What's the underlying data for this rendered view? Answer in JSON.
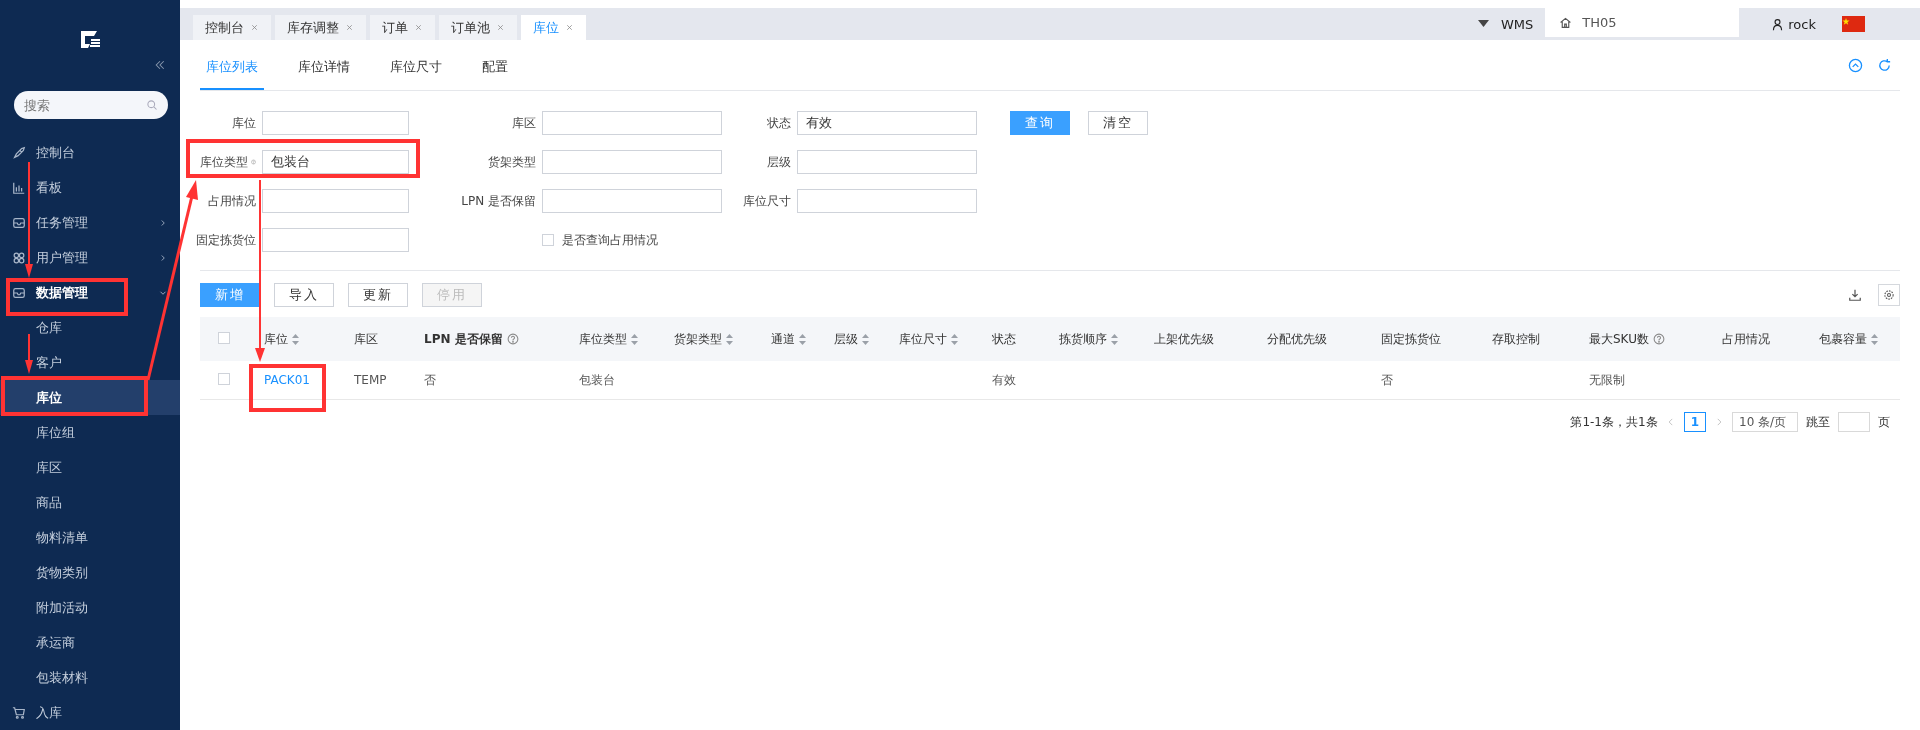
{
  "sidebar": {
    "search": {
      "placeholder": "搜索"
    },
    "menu": [
      {
        "label": "控制台",
        "selected": false
      },
      {
        "label": "看板",
        "selected": false
      },
      {
        "label": "任务管理",
        "selected": false,
        "expanded": false
      },
      {
        "label": "用户管理",
        "selected": false,
        "expanded": false
      },
      {
        "label": "数据管理",
        "selected": false,
        "expanded": true,
        "children": [
          {
            "label": "仓库",
            "selected": false
          },
          {
            "label": "客户",
            "selected": false
          },
          {
            "label": "库位",
            "selected": true
          },
          {
            "label": "库位组",
            "selected": false
          },
          {
            "label": "库区",
            "selected": false
          },
          {
            "label": "商品",
            "selected": false
          },
          {
            "label": "物料清单",
            "selected": false
          },
          {
            "label": "货物类别",
            "selected": false
          },
          {
            "label": "附加活动",
            "selected": false
          },
          {
            "label": "承运商",
            "selected": false
          },
          {
            "label": "包装材料",
            "selected": false
          }
        ]
      },
      {
        "label": "入库",
        "selected": false
      }
    ]
  },
  "tabs": [
    {
      "label": "控制台",
      "selected": false
    },
    {
      "label": "库存调整",
      "selected": false
    },
    {
      "label": "订单",
      "selected": false
    },
    {
      "label": "订单池",
      "selected": false
    },
    {
      "label": "库位",
      "selected": true
    }
  ],
  "header": {
    "system": "WMS",
    "warehouse": "TH05",
    "user": "rock"
  },
  "subtabs": [
    {
      "label": "库位列表",
      "selected": true
    },
    {
      "label": "库位详情",
      "selected": false
    },
    {
      "label": "库位尺寸",
      "selected": false
    },
    {
      "label": "配置",
      "selected": false
    }
  ],
  "filters": [
    [
      {
        "label": "库位"
      },
      {
        "label": "库区"
      },
      {
        "label": "状态",
        "value": "有效"
      }
    ],
    [
      {
        "label": "库位类型",
        "help": true,
        "value": "包装台"
      },
      {
        "label": "货架类型"
      },
      {
        "label": "层级"
      }
    ],
    [
      {
        "label": "占用情况"
      },
      {
        "label": "LPN 是否保留"
      },
      {
        "label": "库位尺寸"
      }
    ],
    [
      {
        "label": "固定拣货位"
      },
      {
        "kind": "checkbox",
        "label": "是否查询占用情况",
        "checked": false
      }
    ]
  ],
  "filter_buttons": [
    {
      "label": "查询",
      "kind": "primary"
    },
    {
      "label": "清空",
      "kind": "default"
    }
  ],
  "toolbar": [
    {
      "label": "新增",
      "kind": "primary",
      "disabled": false
    },
    {
      "label": "导入",
      "kind": "default",
      "disabled": false
    },
    {
      "label": "更新",
      "kind": "default",
      "disabled": false
    },
    {
      "label": "停用",
      "kind": "default",
      "disabled": true
    }
  ],
  "table": {
    "header_checked": false,
    "columns": [
      {
        "label": "库位",
        "sortable": true
      },
      {
        "label": "库区"
      },
      {
        "label": "LPN 是否保留",
        "help": true,
        "bold": true
      },
      {
        "label": "库位类型",
        "sortable": true
      },
      {
        "label": "货架类型",
        "sortable": true
      },
      {
        "label": "通道",
        "sortable": true
      },
      {
        "label": "层级",
        "sortable": true
      },
      {
        "label": "库位尺寸",
        "sortable": true
      },
      {
        "label": "状态"
      },
      {
        "label": "拣货顺序",
        "sortable": true
      },
      {
        "label": "上架优先级"
      },
      {
        "label": "分配优先级"
      },
      {
        "label": "固定拣货位"
      },
      {
        "label": "存取控制"
      },
      {
        "label": "最大SKU数",
        "help": true
      },
      {
        "label": "占用情况"
      },
      {
        "label": "包裹容量",
        "sortable": true
      }
    ],
    "rows": [
      {
        "selected": false,
        "cells": [
          "PACK01",
          "TEMP",
          "否",
          "包装台",
          "",
          "",
          "",
          "",
          "有效",
          "",
          "",
          "",
          "否",
          "",
          "无限制",
          "",
          ""
        ]
      }
    ]
  },
  "pagination": {
    "summary": "第1-1条，共1条",
    "pages": [
      {
        "label": "1",
        "selected": true
      }
    ],
    "page_size": "10 条/页",
    "jump_label": "跳至",
    "page_suffix": "页"
  }
}
